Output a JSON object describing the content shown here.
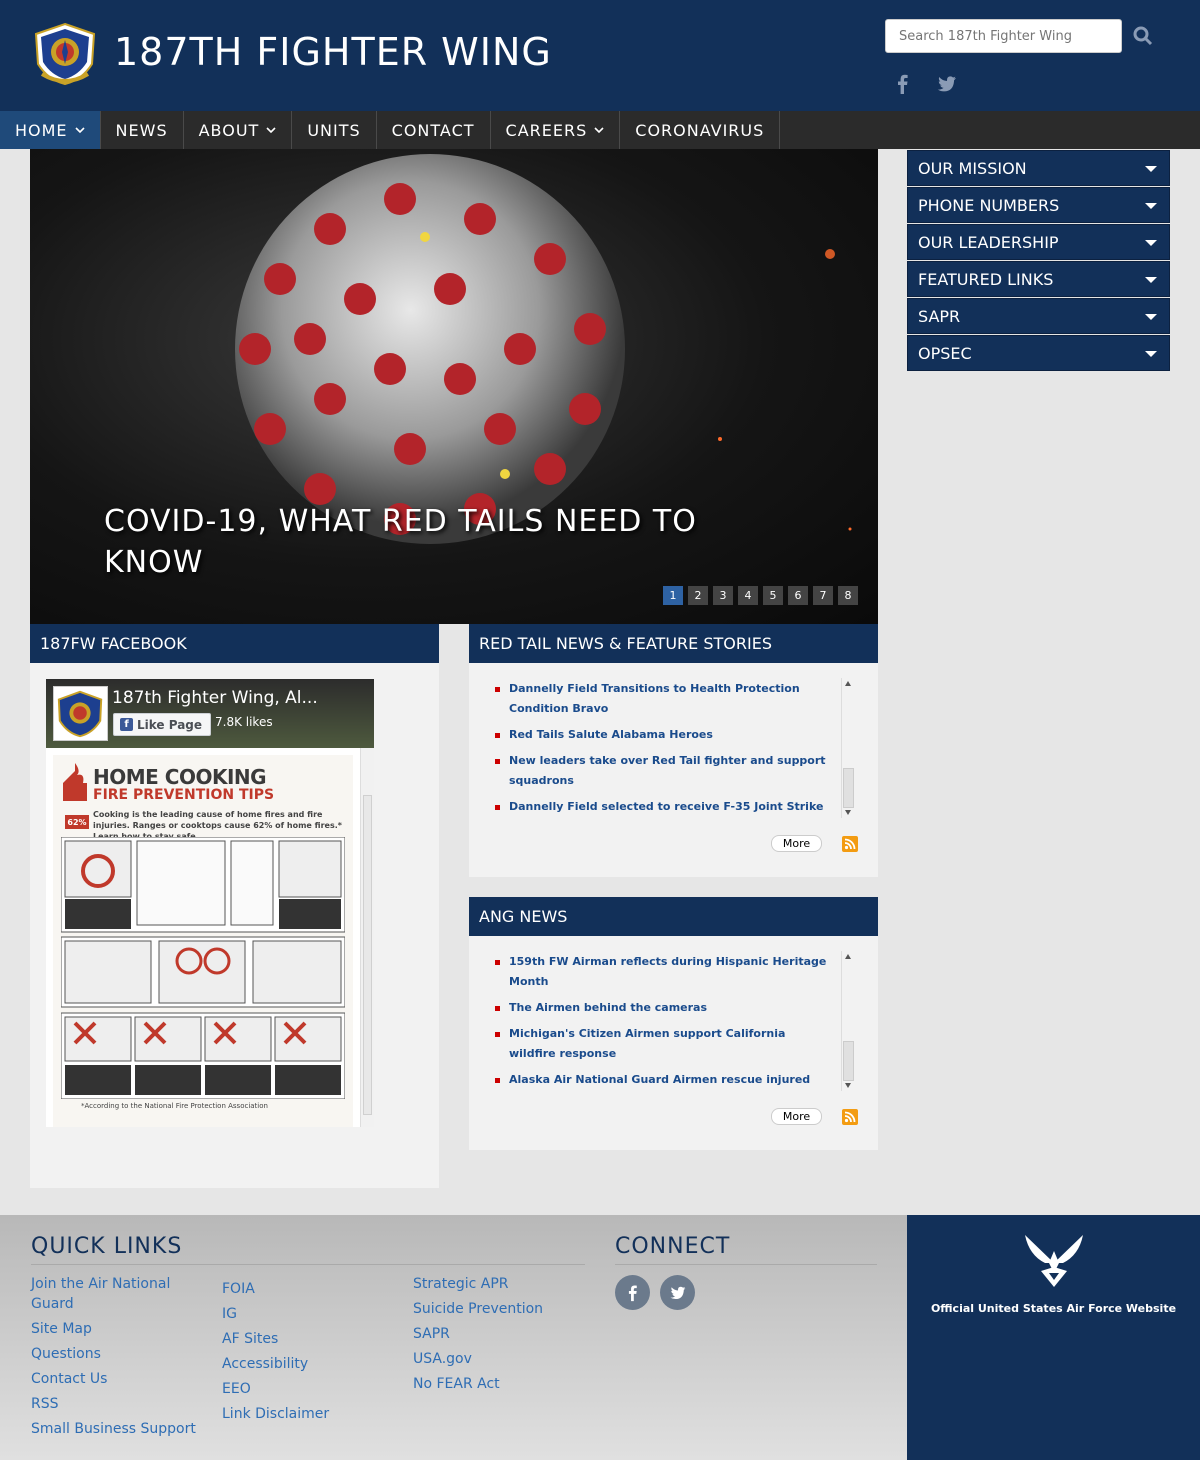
{
  "header": {
    "title": "187TH FIGHTER WING",
    "search_placeholder": "Search 187th Fighter Wing",
    "social": [
      "facebook-icon",
      "twitter-icon"
    ]
  },
  "nav": [
    {
      "label": "HOME",
      "dropdown": true,
      "active": true
    },
    {
      "label": "NEWS",
      "dropdown": false
    },
    {
      "label": "ABOUT",
      "dropdown": true
    },
    {
      "label": "UNITS",
      "dropdown": false
    },
    {
      "label": "CONTACT",
      "dropdown": false
    },
    {
      "label": "CAREERS",
      "dropdown": true
    },
    {
      "label": "CORONAVIRUS",
      "dropdown": false
    }
  ],
  "hero": {
    "title": "COVID-19, WHAT RED TAILS NEED TO KNOW",
    "pages": [
      "1",
      "2",
      "3",
      "4",
      "5",
      "6",
      "7",
      "8"
    ],
    "current_page": "1"
  },
  "sidebar": [
    "OUR MISSION",
    "PHONE NUMBERS",
    "OUR LEADERSHIP",
    "FEATURED LINKS",
    "SAPR",
    "OPSEC"
  ],
  "facebook": {
    "heading": "187FW FACEBOOK",
    "page_name": "187th Fighter Wing, Al...",
    "like_label": "Like Page",
    "likes": "7.8K likes",
    "post": {
      "title": "HOME COOKING",
      "subtitle": "FIRE PREVENTION TIPS",
      "percent": "62%",
      "text": "Cooking is the leading cause of home fires and fire injuries. Ranges or cooktops cause 62% of home fires.* Learn how to stay safe.",
      "footnote": "*According to the National Fire Protection Association"
    }
  },
  "red_tail_news": {
    "heading": "RED TAIL NEWS & FEATURE STORIES",
    "items": [
      "Dannelly Field Transitions to Health Protection Condition Bravo",
      "Red Tails Salute Alabama Heroes",
      "New leaders take over Red Tail fighter and support squadrons",
      "Dannelly Field selected to receive F-35 Joint Strike"
    ],
    "more_label": "More"
  },
  "ang_news": {
    "heading": "ANG NEWS",
    "items": [
      "159th FW Airman reflects during Hispanic Heritage Month",
      "The Airmen behind the cameras",
      "Michigan's Citizen Airmen support California wildfire response",
      "Alaska Air National Guard Airmen rescue injured"
    ],
    "more_label": "More"
  },
  "footer": {
    "quick_links_heading": "QUICK LINKS",
    "connect_heading": "CONNECT",
    "col1": [
      "Join the Air National Guard",
      "Site Map",
      "Questions",
      "Contact Us",
      "RSS",
      "Small Business Support"
    ],
    "col2": [
      "FOIA",
      "IG",
      "AF Sites",
      "Accessibility",
      "EEO",
      "Link Disclaimer"
    ],
    "col3": [
      "Strategic APR",
      "Suicide Prevention",
      "SAPR",
      "USA.gov",
      "No FEAR Act"
    ],
    "af_label": "Official United States Air Force Website"
  }
}
